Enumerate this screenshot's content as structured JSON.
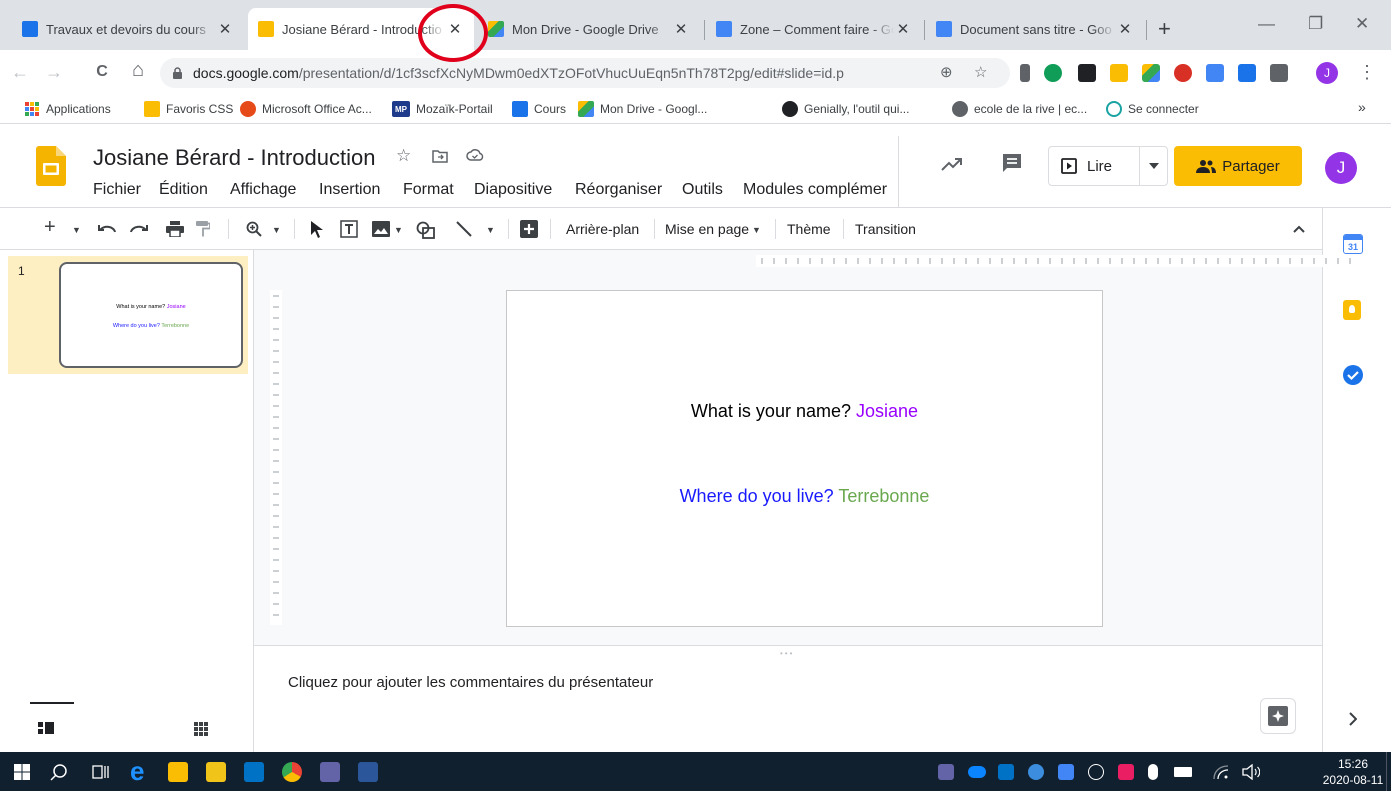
{
  "browser": {
    "tabs": [
      {
        "title": "Travaux et devoirs du cours",
        "close": "✕",
        "icon_color": "#1a73e8"
      },
      {
        "title": "Josiane Bérard - Introductio",
        "close": "✕",
        "icon_color": "#fbbc04",
        "active": true
      },
      {
        "title": "Mon Drive - Google Drive",
        "close": "✕",
        "icon_color": "#fbbc04"
      },
      {
        "title": "Zone – Comment faire - Go",
        "close": "✕",
        "icon_color": "#4285f4"
      },
      {
        "title": "Document sans titre - Goo",
        "close": "✕",
        "icon_color": "#4285f4"
      }
    ],
    "new_tab": "+",
    "window_controls": {
      "minimize": "—",
      "restore": "❐",
      "close": "✕"
    },
    "nav": {
      "back": "←",
      "forward": "→",
      "reload": "C",
      "home": "⌂"
    },
    "url_domain": "docs.google.com",
    "url_path": "/presentation/d/1cf3scfXcNyMDwm0edXTzOFotVhucUuEqn5nTh78T2pg/edit#slide=id.p",
    "profile_initial": "J",
    "menu_dots": "⋮"
  },
  "bookmarks": [
    {
      "label": "Applications",
      "icon": "apps-grid-icon",
      "color": "#ea4335"
    },
    {
      "label": "Favoris CSS",
      "icon": "folder-icon",
      "color": "#fbbc04"
    },
    {
      "label": "Microsoft Office Ac...",
      "icon": "office-icon",
      "color": "#e64a19"
    },
    {
      "label": "Mozaïk-Portail",
      "icon": "mozaik-icon",
      "color": "#1e3a8a"
    },
    {
      "label": "Cours",
      "icon": "classroom-icon",
      "color": "#1a73e8"
    },
    {
      "label": "Mon Drive - Googl...",
      "icon": "drive-icon",
      "color": "#34a853"
    },
    {
      "label": "Genially, l'outil qui...",
      "icon": "genially-icon",
      "color": "#202124"
    },
    {
      "label": "ecole de la rive | ec...",
      "icon": "globe-icon",
      "color": "#5f6368"
    },
    {
      "label": "Se connecter",
      "icon": "login-icon",
      "color": "#1aa3a3"
    }
  ],
  "bookmarks_more": "»",
  "doc": {
    "title": "Josiane Bérard - Introduction",
    "menu": [
      "Fichier",
      "Édition",
      "Affichage",
      "Insertion",
      "Format",
      "Diapositive",
      "Réorganiser",
      "Outils",
      "Modules complémer"
    ],
    "present_label": "Lire",
    "share_label": "Partager",
    "user_initial": "J"
  },
  "toolbar": {
    "background": "Arrière-plan",
    "layout": "Mise en page",
    "theme": "Thème",
    "transition": "Transition"
  },
  "filmstrip": {
    "slide_number": "1"
  },
  "slide": {
    "q1": "What is your name?",
    "a1": "Josiane",
    "q2": "Where do you live?",
    "a2": "Terrebonne"
  },
  "notes": {
    "placeholder": "Cliquez pour ajouter les commentaires du présentateur"
  },
  "side_panel": {
    "calendar_day": "31"
  },
  "taskbar": {
    "time": "15:26",
    "date": "2020-08-11"
  }
}
